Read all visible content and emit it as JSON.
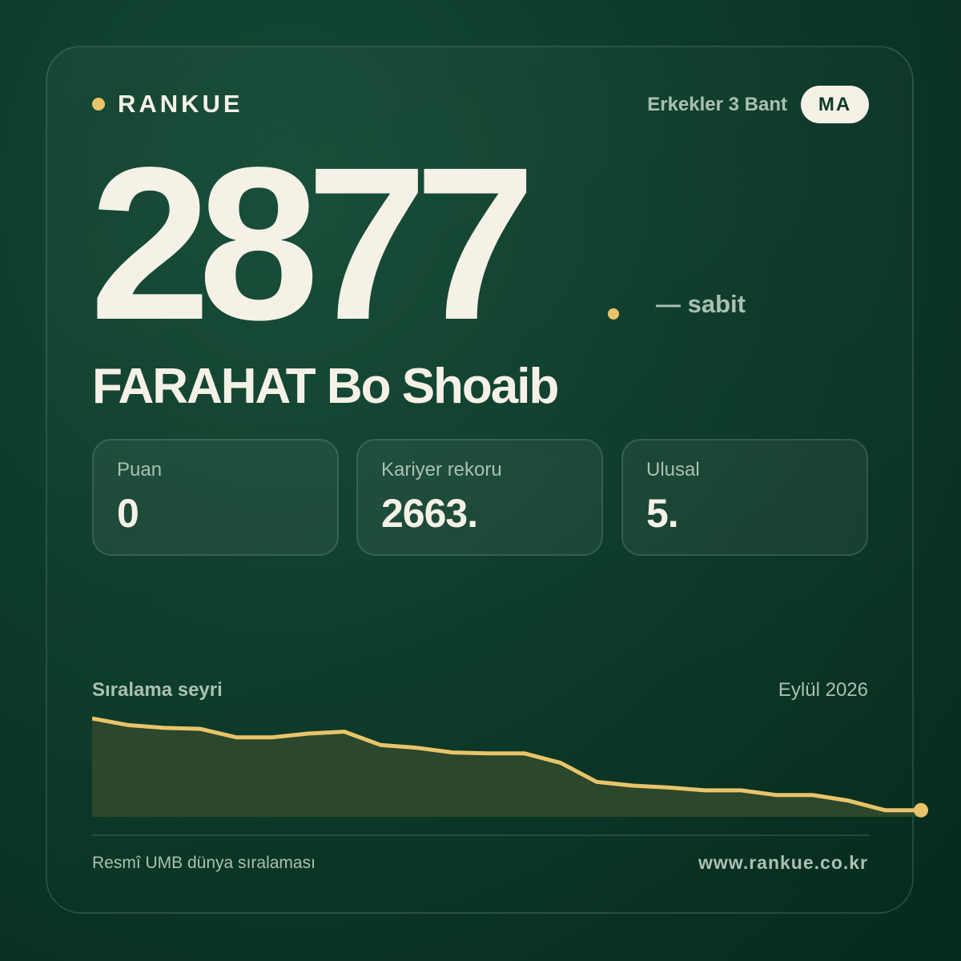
{
  "brand": {
    "name": "RANKUE"
  },
  "header": {
    "category": "Erkekler 3 Bant",
    "country_code": "MA"
  },
  "rank": {
    "value": "2877",
    "change": "— sabit"
  },
  "player": {
    "name": "FARAHAT Bo Shoaib"
  },
  "stats": [
    {
      "label": "Puan",
      "value": "0"
    },
    {
      "label": "Kariyer rekoru",
      "value": "2663."
    },
    {
      "label": "Ulusal",
      "value": "5."
    }
  ],
  "trend": {
    "title": "Sıralama seyri",
    "date": "Eylül 2026",
    "values": [
      2646,
      2653,
      2656,
      2657,
      2666,
      2666,
      2662,
      2660,
      2674,
      2677,
      2682,
      2683,
      2683,
      2693,
      2713,
      2717,
      2719,
      2722,
      2722,
      2727,
      2727,
      2733,
      2743,
      2743
    ],
    "y_range": [
      2640,
      2750
    ],
    "line_color": "#e9c46a",
    "fill_color": "#2c472b"
  },
  "footer": {
    "source": "Resmî UMB dünya sıralaması",
    "url": "www.rankue.co.kr"
  }
}
